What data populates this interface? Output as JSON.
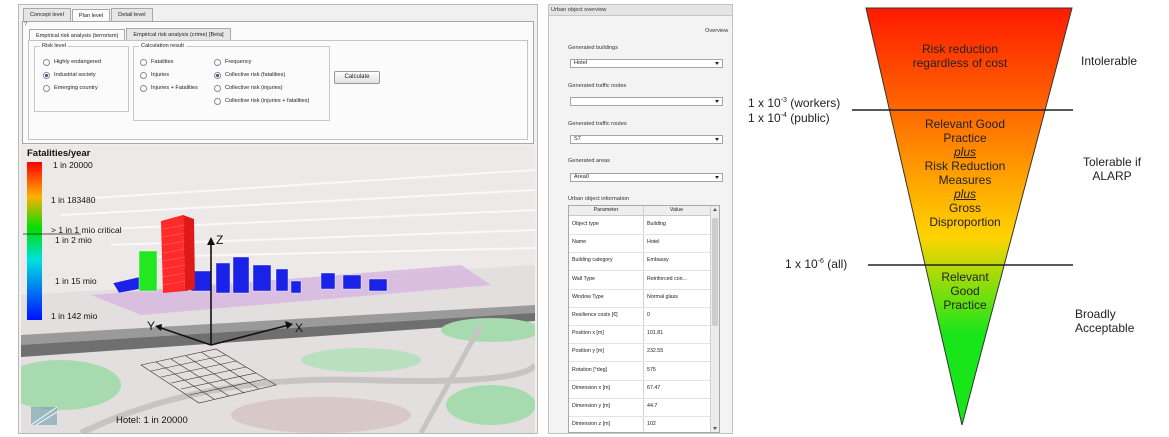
{
  "app": {
    "tabs": [
      "Concept level",
      "Plan level",
      "Detail level"
    ],
    "subtabs": [
      "Empirical risk analysis (terrorism)",
      "Empirical risk analysis (crime) [Beta]"
    ],
    "risk_level": {
      "title": "Risk level",
      "options": [
        "Highly endangered",
        "Industrial society",
        "Emerging country"
      ]
    },
    "calculation_result": {
      "title": "Calculation result",
      "col1": [
        "Fatalities",
        "Injuries",
        "Injuries + Fatalities"
      ],
      "col2": [
        "Frequency",
        "Collective risk (fatalities)",
        "Collective risk (injuries)",
        "Collective risk (injuries + fatalities)"
      ]
    },
    "calculate_label": "Calculate"
  },
  "scene": {
    "legend_title": "Fatalities/year",
    "legend_labels": [
      "1 in 20000",
      "1 in 183480",
      "> 1 in 1 mio critical",
      "1 in 2 mio",
      "1 in 15 mio",
      "1 in 142 mio"
    ],
    "axis_labels": {
      "x": "X",
      "y": "Y",
      "z": "Z"
    },
    "status": "Hotel: 1 in 20000"
  },
  "side": {
    "title": "Urban object overview",
    "overview_label": "Overview",
    "buildings_label": "Generated buildings",
    "buildings_value": "Hotel",
    "traffic_nodes_label": "Generated traffic nodes",
    "traffic_nodes_value": "",
    "traffic_routes_label": "Generated traffic routes",
    "traffic_routes_value": "S7",
    "areas_label": "Generated areas",
    "areas_value": "Area0",
    "info_label": "Urban object information",
    "table": {
      "headers": [
        "Parameter",
        "Value"
      ],
      "rows": [
        [
          "Object type",
          "Building"
        ],
        [
          "Name",
          "Hotel"
        ],
        [
          "Building category",
          "Embassy"
        ],
        [
          "Wall Type",
          "Reinforced con..."
        ],
        [
          "Window Type",
          "Normal glass"
        ],
        [
          "Resilience costs [€]",
          "0"
        ],
        [
          "Position x [m]",
          "101.81"
        ],
        [
          "Position y [m]",
          "232.55"
        ],
        [
          "Rotation [°deg]",
          "575"
        ],
        [
          "Dimension x [m]",
          "67.47"
        ],
        [
          "Dimension y [m]",
          "44.7"
        ],
        [
          "Dimension z [m]",
          "102"
        ]
      ]
    }
  },
  "diagram": {
    "colors": {
      "top": "#ff1a00",
      "middle": "#ffd400",
      "bottom": "#19e619"
    },
    "zone_texts": {
      "top": [
        "Risk reduction",
        "regardless of cost"
      ],
      "middle": [
        "Relevant Good",
        "Practice",
        "plus",
        "Risk Reduction",
        "Measures",
        "plus",
        "Gross",
        "Disproportion"
      ],
      "bottom": [
        "Relevant",
        "Good",
        "Practice"
      ]
    },
    "threshold_upper": [
      "1 x 10",
      "-3",
      " (workers)",
      "1 x 10",
      "-4",
      " (public)"
    ],
    "threshold_lower": [
      "1 x 10",
      "-6",
      " (all)"
    ],
    "right_labels": {
      "intolerable": "Intolerable",
      "tolerable": [
        "Tolerable if",
        "ALARP"
      ],
      "acceptable": [
        "Broadly",
        "Acceptable"
      ]
    }
  }
}
